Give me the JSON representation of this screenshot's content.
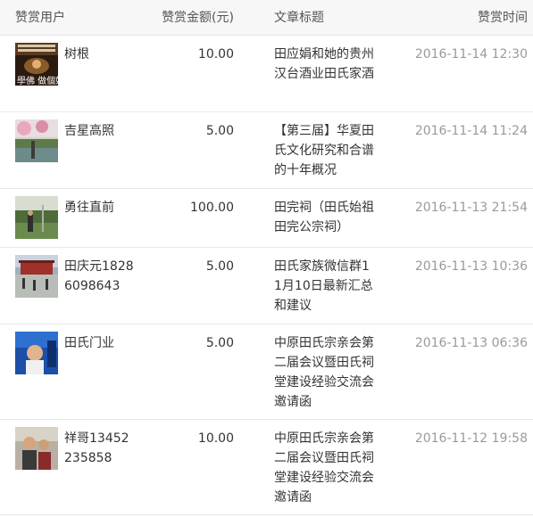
{
  "header": {
    "user": "赞赏用户",
    "amount": "赞赏金额(元)",
    "title": "文章标题",
    "time": "赞赏时间"
  },
  "rows": [
    {
      "avatar_icon": "avatar-image",
      "avatar_text": "學佛 做個好 人",
      "name": "树根",
      "amount": "10.00",
      "title": "田应娟和她的贵州汉台酒业田氏家酒",
      "time": "2016-11-14 12:30"
    },
    {
      "avatar_icon": "avatar-image",
      "name": "吉星高照",
      "amount": "5.00",
      "title": "【第三届】华夏田氏文化研究和合谱的十年概况",
      "time": "2016-11-14 11:24"
    },
    {
      "avatar_icon": "avatar-image",
      "name": "勇往直前",
      "amount": "100.00",
      "title": "田完祠（田氏始祖田完公宗祠）",
      "time": "2016-11-13 21:54"
    },
    {
      "avatar_icon": "avatar-image",
      "name": "田庆元18286098643",
      "amount": "5.00",
      "title": "田氏家族微信群11月10日最新汇总和建议",
      "time": "2016-11-13 10:36"
    },
    {
      "avatar_icon": "avatar-image",
      "name": "田氏门业",
      "amount": "5.00",
      "title": "中原田氏宗亲会第二届会议暨田氏祠堂建设经验交流会邀请函",
      "time": "2016-11-13 06:36"
    },
    {
      "avatar_icon": "avatar-image",
      "name": "祥哥13452235858",
      "amount": "10.00",
      "title": "中原田氏宗亲会第二届会议暨田氏祠堂建设经验交流会邀请函",
      "time": "2016-11-12 19:58"
    }
  ]
}
